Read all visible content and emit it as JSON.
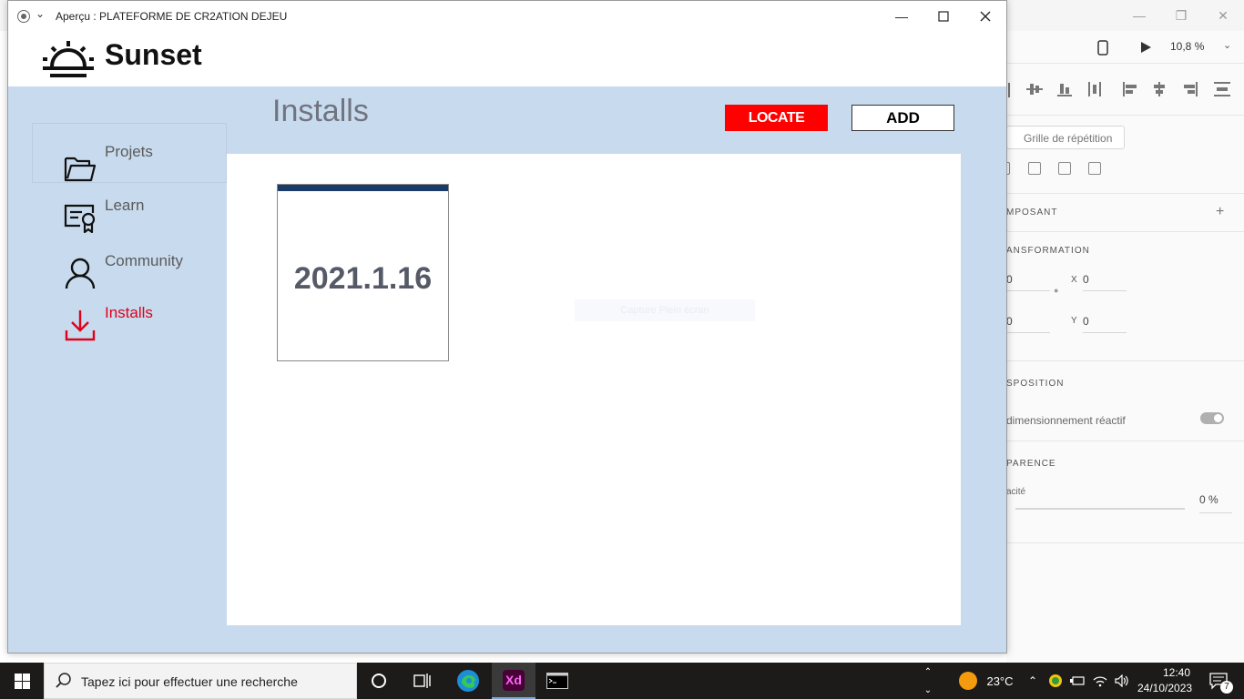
{
  "colors": {
    "accent_red": "#ff0000",
    "active_nav": "#e1001a",
    "app_bg": "#c8daed",
    "card_bar": "#1a3a68"
  },
  "window": {
    "title": "Aperçu : PLATEFORME DE CR2ATION DEJEU",
    "minimize_icon": "minimize-icon",
    "maximize_icon": "maximize-icon",
    "close_icon": "close-icon"
  },
  "app": {
    "name": "Sunset",
    "logo_icon": "sunrise-icon"
  },
  "sidebar": {
    "items": [
      {
        "label": "Projets",
        "icon": "folder-icon",
        "active": false
      },
      {
        "label": "Learn",
        "icon": "certificate-icon",
        "active": false
      },
      {
        "label": "Community",
        "icon": "user-icon",
        "active": false
      },
      {
        "label": "Installs",
        "icon": "download-icon",
        "active": true
      }
    ]
  },
  "main": {
    "title": "Installs",
    "locate_label": "LOCATE",
    "add_label": "ADD",
    "installs": [
      {
        "version": "2021.1.16"
      }
    ],
    "ghost_label": "Capture Plein écran"
  },
  "xd_panel": {
    "zoom": "10,8 %",
    "repeat_grid": "Grille de répétition",
    "component_heading": "MPOSANT",
    "transform_heading": "ANSFORMATION",
    "w_value": "0",
    "h_value": "0",
    "x_label": "X",
    "x_value": "0",
    "y_label": "Y",
    "y_value": "0",
    "layout_heading": "SPOSITION",
    "responsive_label": "dimensionnement réactif",
    "appearance_heading": "PARENCE",
    "opacity_label": "acité",
    "opacity_value": "0 %"
  },
  "taskbar": {
    "search_placeholder": "Tapez ici pour effectuer une recherche",
    "weather_temp": "23°C",
    "time": "12:40",
    "date": "24/10/2023",
    "notification_count": "7"
  }
}
